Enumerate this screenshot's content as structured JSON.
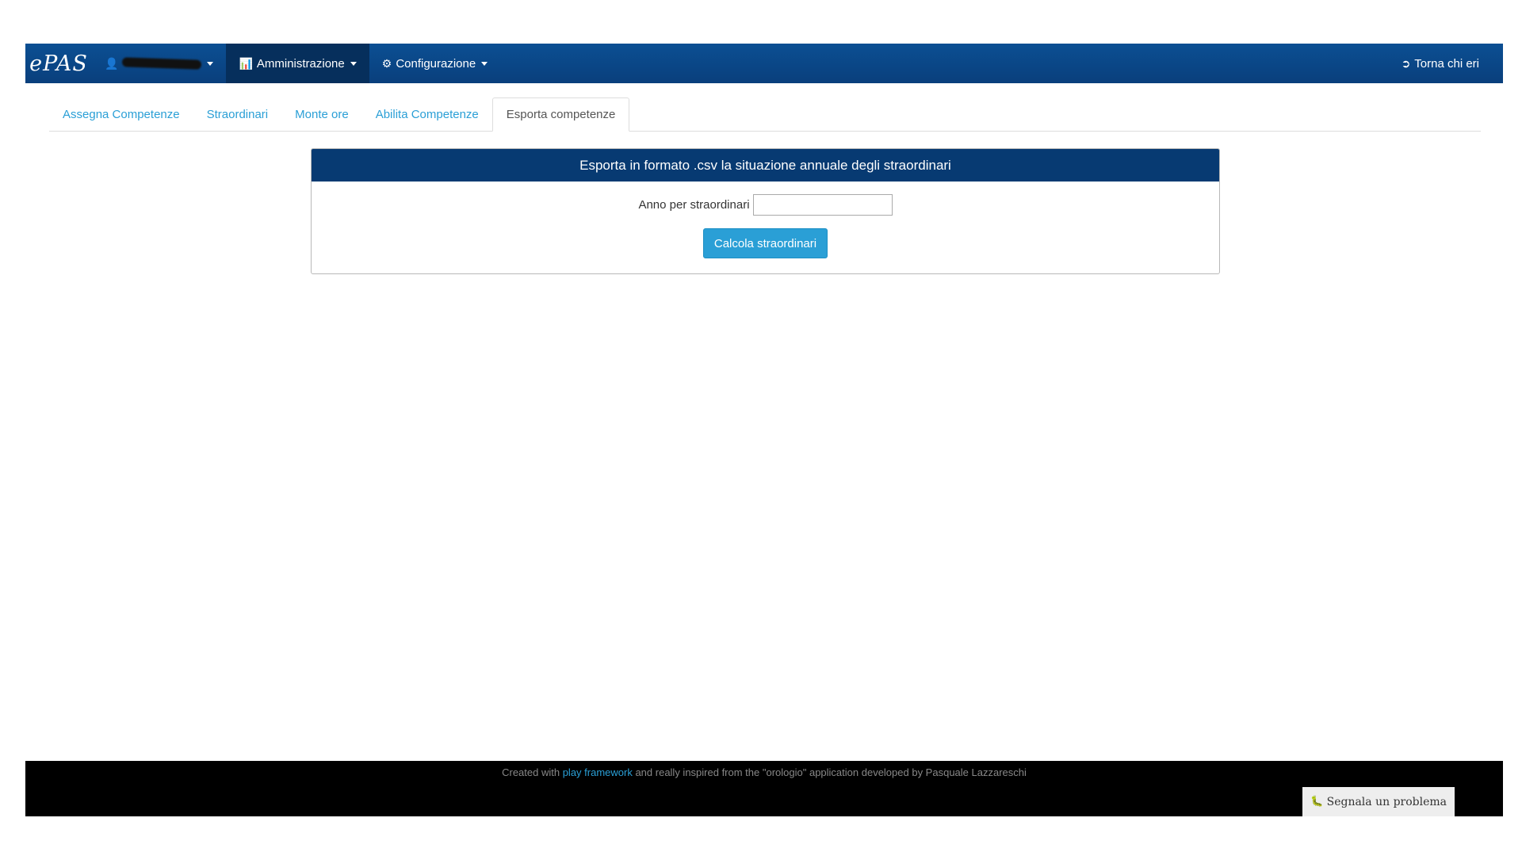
{
  "navbar": {
    "brand": "ePAS",
    "user_menu": {
      "icon": "user-icon"
    },
    "admin_menu": {
      "label": "Amministrazione",
      "icon": "bar-chart-icon"
    },
    "config_menu": {
      "label": "Configurazione",
      "icon": "gear-icon"
    },
    "back_link": {
      "label": "Torna chi eri",
      "icon": "sign-out-icon"
    }
  },
  "tabs": [
    {
      "label": "Assegna Competenze",
      "active": false
    },
    {
      "label": "Straordinari",
      "active": false
    },
    {
      "label": "Monte ore",
      "active": false
    },
    {
      "label": "Abilita Competenze",
      "active": false
    },
    {
      "label": "Esporta competenze",
      "active": true
    }
  ],
  "panel": {
    "title": "Esporta in formato .csv la situazione annuale degli straordinari",
    "field_label": "Anno per straordinari",
    "field_value": "",
    "submit_label": "Calcola straordinari"
  },
  "footer": {
    "prefix": "Created with ",
    "link": "play framework",
    "suffix": " and really inspired from the \"orologio\" application developed by Pasquale Lazzareschi",
    "report_label": "Segnala un problema",
    "report_icon": "bug-icon"
  },
  "colors": {
    "navbar": "#0a3f7c",
    "panel_heading": "#073a72",
    "accent": "#2a9fd6",
    "footer": "#000000"
  }
}
